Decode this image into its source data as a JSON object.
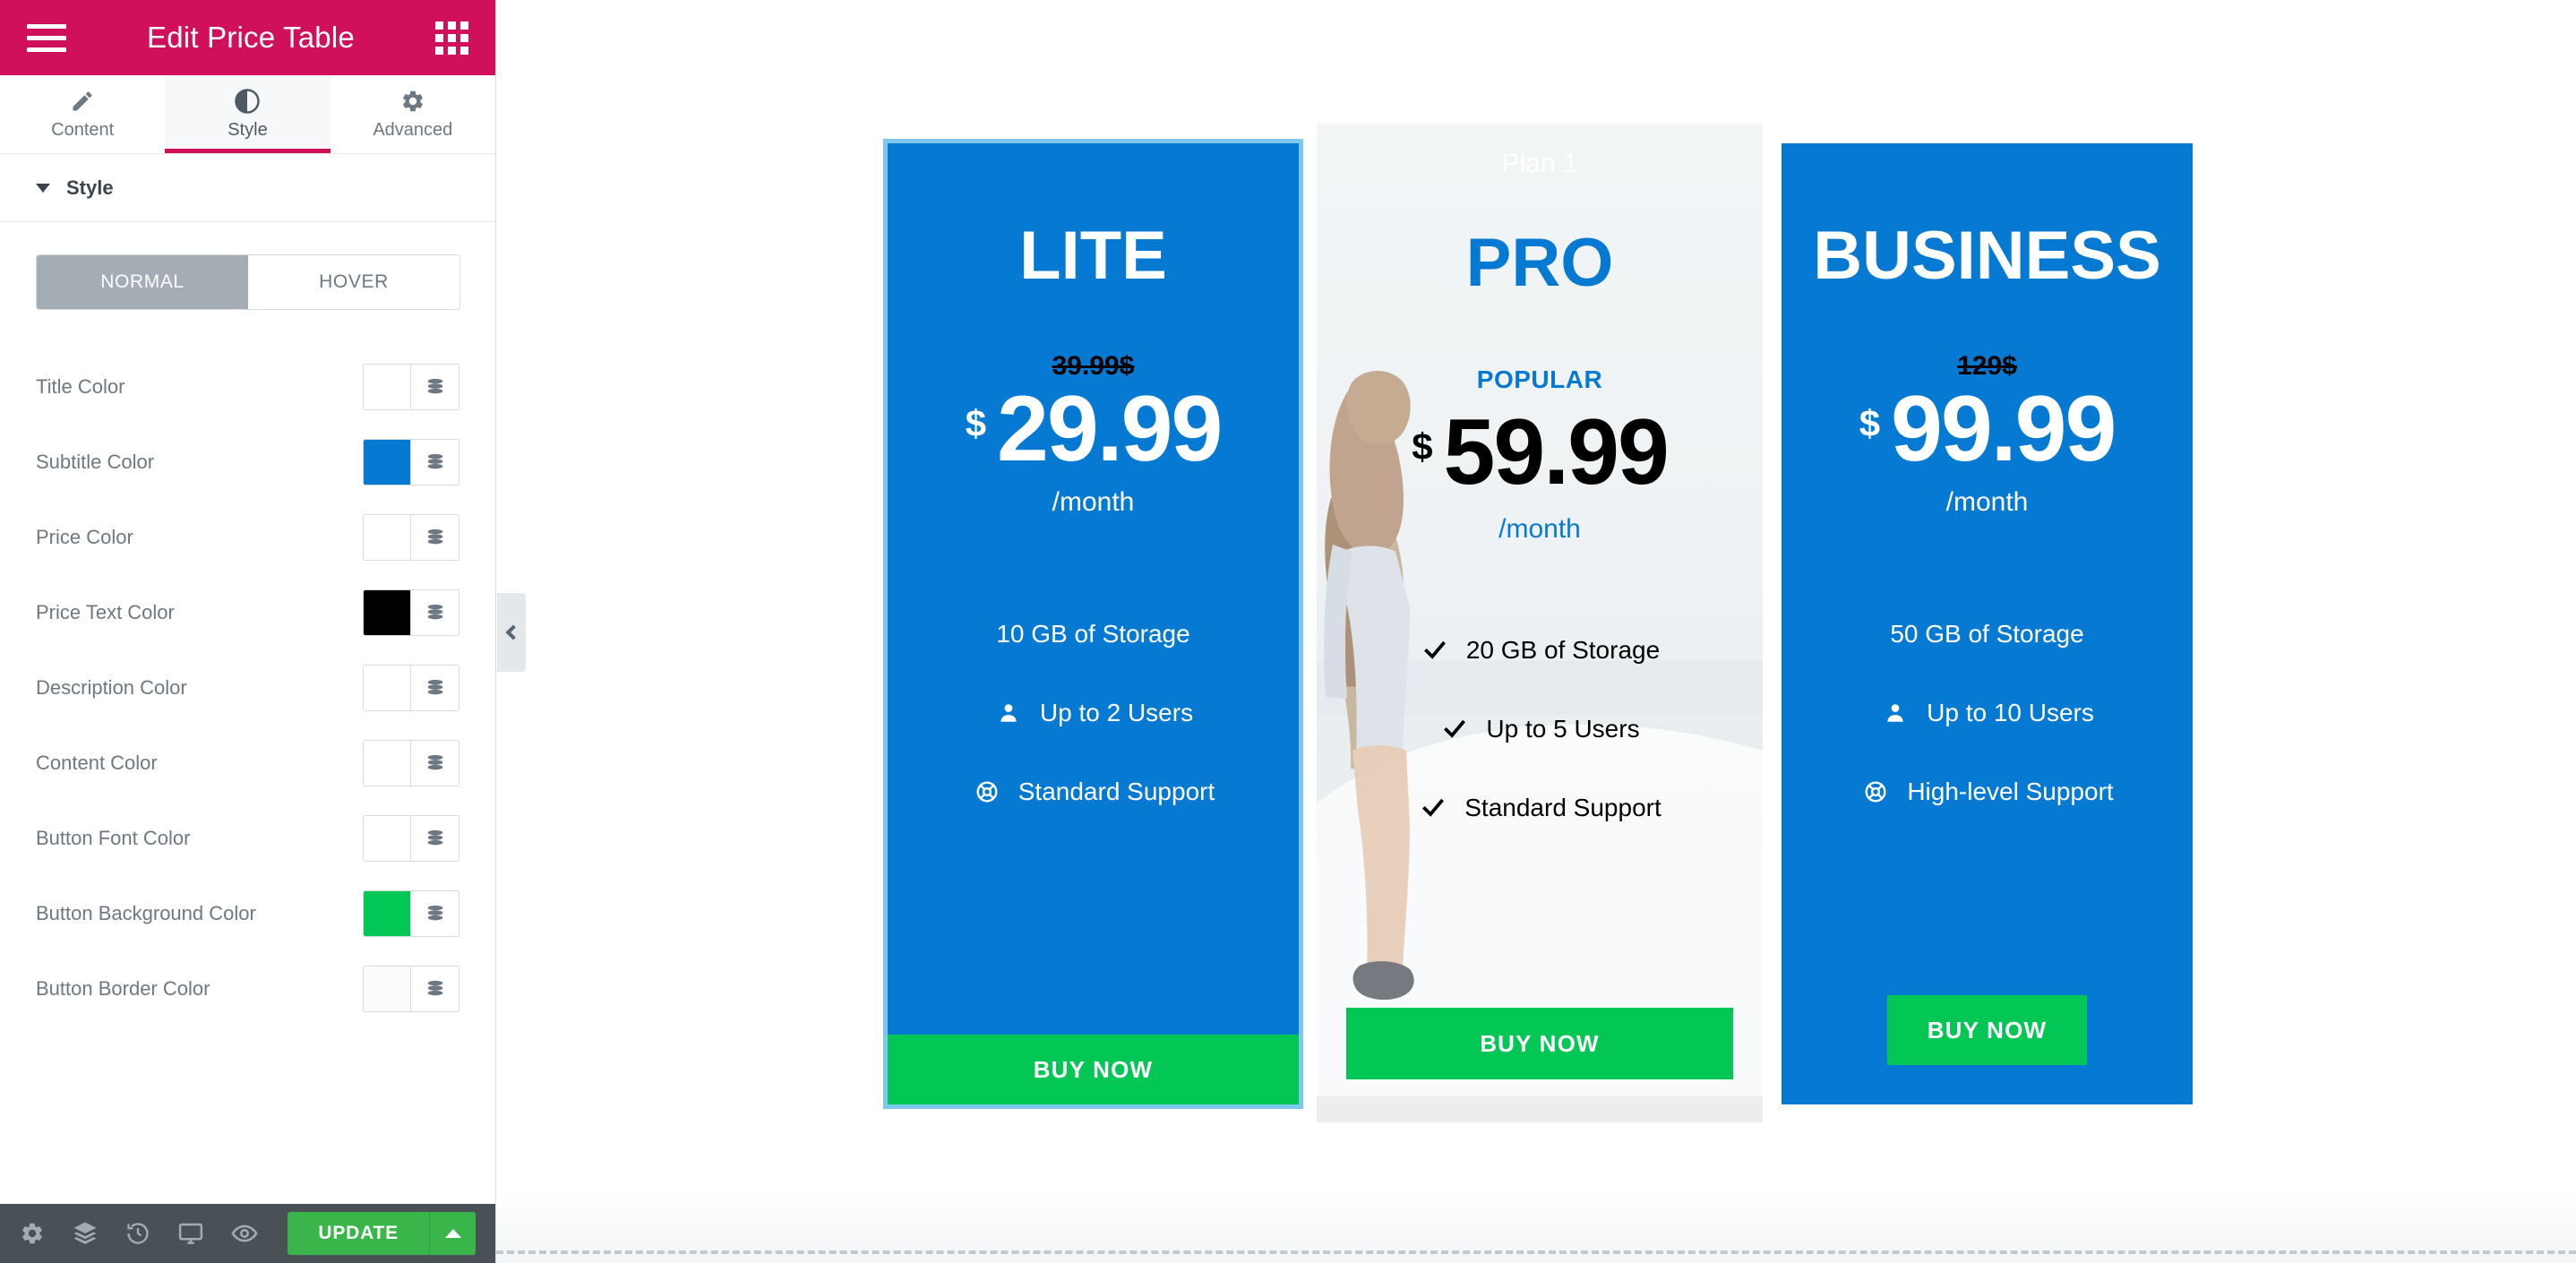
{
  "panel": {
    "header": {
      "title": "Edit Price Table",
      "menu_icon": "hamburger-icon",
      "apps_icon": "grid-icon"
    },
    "tabs": [
      {
        "label": "Content",
        "icon": "pencil-icon",
        "active": false
      },
      {
        "label": "Style",
        "icon": "contrast-icon",
        "active": true
      },
      {
        "label": "Advanced",
        "icon": "gear-icon",
        "active": false
      }
    ],
    "section": {
      "label": "Style",
      "expanded": true
    },
    "state_toggle": {
      "options": [
        "NORMAL",
        "HOVER"
      ],
      "selected": "NORMAL"
    },
    "color_controls": [
      {
        "label": "Title Color",
        "value": "",
        "swatch": "#ffffff"
      },
      {
        "label": "Subtitle Color",
        "value": "#0679d3",
        "swatch": "#0679d3"
      },
      {
        "label": "Price Color",
        "value": "",
        "swatch": "#ffffff"
      },
      {
        "label": "Price Text Color",
        "value": "#000000",
        "swatch": "#000000"
      },
      {
        "label": "Description Color",
        "value": "",
        "swatch": "#ffffff"
      },
      {
        "label": "Content Color",
        "value": "",
        "swatch": "#ffffff"
      },
      {
        "label": "Button Font Color",
        "value": "",
        "swatch": "#ffffff"
      },
      {
        "label": "Button Background Color",
        "value": "#03c755",
        "swatch": "#03c755"
      },
      {
        "label": "Button Border Color",
        "value": "",
        "swatch": "#fafbfb"
      }
    ],
    "footer": {
      "icons": [
        "gear-icon",
        "layers-icon",
        "history-icon",
        "responsive-mode-icon",
        "preview-icon"
      ],
      "update_label": "UPDATE",
      "update_arrow": "chevron-up-icon"
    },
    "collapse_handle": "chevron-left-icon"
  },
  "canvas": {
    "cards": [
      {
        "id": "lite",
        "ribbon": "",
        "title": "LITE",
        "subtitle": "",
        "original_price": "39.99$",
        "currency": "$",
        "amount": "29.99",
        "period": "/month",
        "features": [
          {
            "icon": "",
            "text": "10 GB of Storage"
          },
          {
            "icon": "person-icon",
            "text": "Up to 2 Users"
          },
          {
            "icon": "lifebuoy-icon",
            "text": "Standard Support"
          }
        ],
        "button_label": "BUY NOW",
        "background": "#0679d3",
        "selected": true
      },
      {
        "id": "pro",
        "ribbon": "Plan 1",
        "title": "PRO",
        "subtitle": "POPULAR",
        "original_price": "",
        "currency": "$",
        "amount": "59.99",
        "period": "/month",
        "features": [
          {
            "icon": "check-icon",
            "text": "20 GB of Storage"
          },
          {
            "icon": "check-icon",
            "text": "Up to 5 Users"
          },
          {
            "icon": "check-icon",
            "text": "Standard Support"
          }
        ],
        "button_label": "BUY NOW",
        "background": "photo",
        "selected": false
      },
      {
        "id": "business",
        "ribbon": "",
        "title": "BUSINESS",
        "subtitle": "",
        "original_price": "129$",
        "currency": "$",
        "amount": "99.99",
        "period": "/month",
        "features": [
          {
            "icon": "",
            "text": "50 GB of Storage"
          },
          {
            "icon": "person-icon",
            "text": "Up to 10 Users"
          },
          {
            "icon": "lifebuoy-icon",
            "text": "High-level Support"
          }
        ],
        "button_label": "BUY NOW",
        "background": "#0679d3",
        "selected": false
      }
    ]
  },
  "colors": {
    "brand_magenta": "#d0105a",
    "card_blue": "#0679d3",
    "button_green": "#03c755",
    "update_green": "#39b54a",
    "panel_footer": "#495157",
    "selection_outline": "#7ec8f0"
  }
}
